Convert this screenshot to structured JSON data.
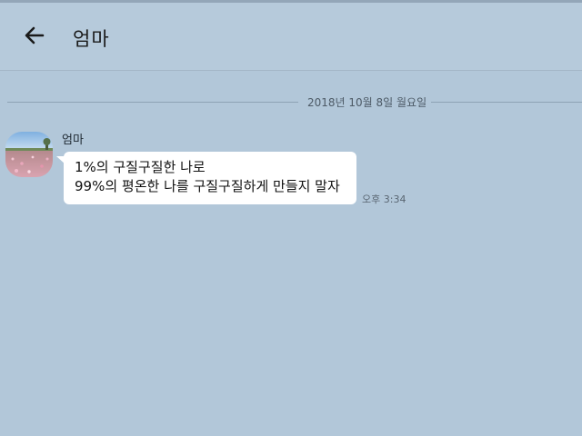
{
  "header": {
    "title": "엄마",
    "back_icon": "arrow-left-icon"
  },
  "divider": {
    "date": "2018년 10월 8일 월요일"
  },
  "messages": [
    {
      "sender": "엄마",
      "avatar": "flower-field-photo",
      "lines": [
        "1%의 구질구질한 나로",
        "99%의 평온한 나를 구질구질하게 만들지 말자"
      ],
      "time": "오후 3:34"
    }
  ],
  "colors": {
    "background": "#b2c7d9",
    "header": "#b6cadb",
    "bubble": "#ffffff"
  }
}
